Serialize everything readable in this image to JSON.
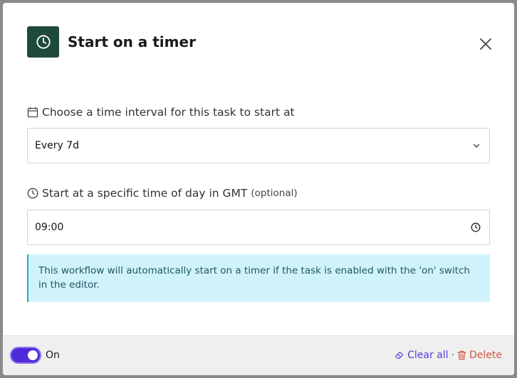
{
  "modal": {
    "title": "Start on a timer",
    "header_icon": "clock-icon",
    "close_icon": "close-icon"
  },
  "interval": {
    "label": "Choose a time interval for this task to start at",
    "icon": "calendar-icon",
    "value": "Every 7d"
  },
  "time_of_day": {
    "label": "Start at a specific time of day in GMT",
    "optional": "(optional)",
    "icon": "clock-icon",
    "value": "09:00"
  },
  "info": {
    "text": "This workflow will automatically start on a timer if the task is enabled with the 'on' switch in the editor."
  },
  "footer": {
    "toggle_state": "on",
    "toggle_label": "On",
    "clear_label": "Clear all",
    "separator": "·",
    "delete_label": "Delete"
  },
  "colors": {
    "header_icon_bg": "#1f4a3b",
    "toggle": "#4f2bd9",
    "clear": "#5b39d8",
    "delete": "#d2553f",
    "info_bg": "#d0f3fb",
    "info_border": "#2aa4c4"
  }
}
